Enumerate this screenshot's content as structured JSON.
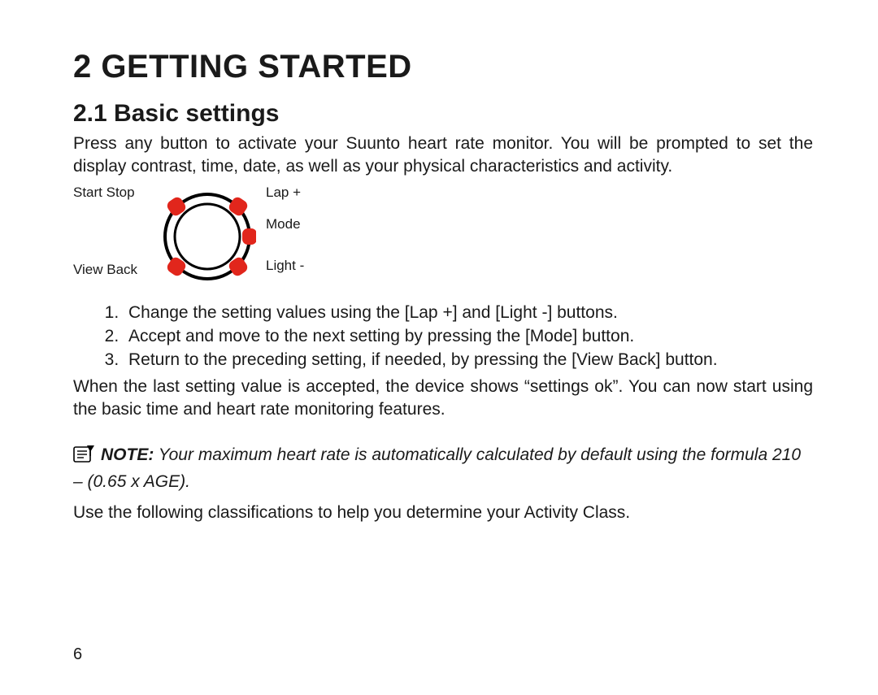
{
  "chapter_title": "2  GETTING STARTED",
  "section_title": "2.1  Basic settings",
  "intro": "Press any button to activate your Suunto heart rate monitor. You will be prompted to set the display contrast, time, date, as well as your physical characteristics and activity.",
  "diagram": {
    "top_left": "Start Stop",
    "bottom_left": "View Back",
    "top_right": "Lap +",
    "mid_right": "Mode",
    "bottom_right": "Light -"
  },
  "steps": [
    "Change the setting values using the [Lap +] and [Light -] buttons.",
    "Accept and move to the next setting by pressing the [Mode] button.",
    "Return to the preceding setting, if needed, by pressing the [View Back] button."
  ],
  "after_steps": "When the last setting value is accepted, the device shows “settings ok”. You can now start using the basic time and heart rate monitoring features.",
  "note_label": "NOTE:",
  "note_body": " Your maximum heart rate is automatically calculated by default using the formula 210 – (0.65 x AGE).",
  "closing": "Use the following classifications to help you determine your Activity Class.",
  "page_number": "6"
}
